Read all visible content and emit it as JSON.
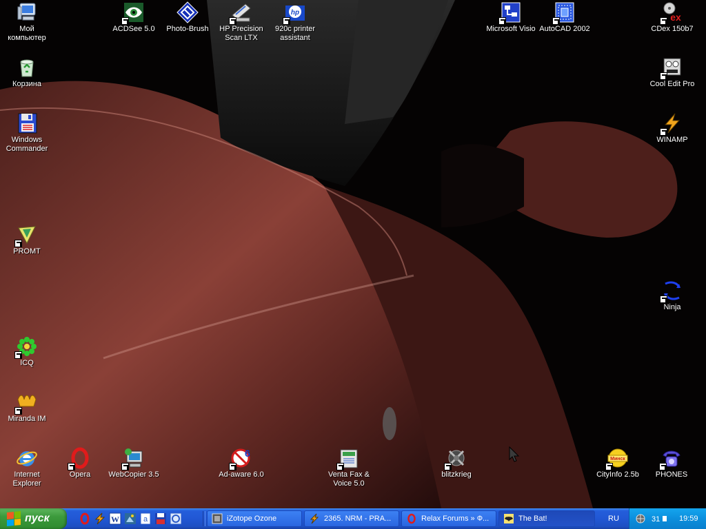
{
  "desktop": {
    "icons_left": [
      {
        "label": "Мой\nкомпьютер",
        "icon": "my-computer-icon",
        "shortcut": false
      },
      {
        "label": "Корзина",
        "icon": "recycle-bin-icon",
        "shortcut": false
      },
      {
        "label": "Windows\nCommander",
        "icon": "windows-commander-icon",
        "shortcut": false
      },
      {
        "label": "PROMT",
        "icon": "promt-icon",
        "shortcut": true
      },
      {
        "label": "ICQ",
        "icon": "icq-flower-icon",
        "shortcut": true
      },
      {
        "label": "Miranda IM",
        "icon": "miranda-icon",
        "shortcut": true
      },
      {
        "label": "Internet\nExplorer",
        "icon": "internet-explorer-icon",
        "shortcut": false
      }
    ],
    "icons_top": [
      {
        "label": "ACDSee 5.0",
        "icon": "acdsee-eye-icon",
        "shortcut": true
      },
      {
        "label": "Photo-Brush",
        "icon": "photo-brush-icon",
        "shortcut": false
      },
      {
        "label": "HP Precision\nScan LTX",
        "icon": "scanner-icon",
        "shortcut": true
      },
      {
        "label": "920c printer\nassistant",
        "icon": "hp-logo-icon",
        "shortcut": true
      },
      {
        "label": "Microsoft Visio",
        "icon": "visio-icon",
        "shortcut": true
      },
      {
        "label": "AutoCAD 2002",
        "icon": "autocad-icon",
        "shortcut": true
      }
    ],
    "icons_right": [
      {
        "label": "CDex 150b7",
        "icon": "cdex-icon",
        "shortcut": true
      },
      {
        "label": "Cool Edit Pro",
        "icon": "cool-edit-icon",
        "shortcut": true
      },
      {
        "label": "WINAMP",
        "icon": "winamp-bolt-icon",
        "shortcut": true
      },
      {
        "label": "Ninja",
        "icon": "ninja-arrows-icon",
        "shortcut": true
      }
    ],
    "icons_bottom": [
      {
        "label": "Opera",
        "icon": "opera-icon",
        "shortcut": true
      },
      {
        "label": "WebCopier 3.5",
        "icon": "webcopier-icon",
        "shortcut": true
      },
      {
        "label": "Ad-aware 6.0",
        "icon": "adaware-icon",
        "shortcut": true
      },
      {
        "label": "Venta Fax &\nVoice 5.0",
        "icon": "ventafax-icon",
        "shortcut": true
      },
      {
        "label": "blitzkrieg",
        "icon": "blitzkrieg-icon",
        "shortcut": true
      },
      {
        "label": "CityInfo 2.5b",
        "icon": "cityinfo-icon",
        "shortcut": true
      },
      {
        "label": "PHONES",
        "icon": "phone-icon",
        "shortcut": true
      }
    ],
    "cityinfo_badge": "Минск"
  },
  "taskbar": {
    "start_label": "пуск",
    "quick_launch": [
      "opera-icon",
      "winamp-icon",
      "word-icon",
      "photoshop-icon",
      "ie-page-icon",
      "floppy-save-icon",
      "ie-icon"
    ],
    "tasks": [
      {
        "title": "iZotope Ozone",
        "icon": "izotope-icon",
        "active": false
      },
      {
        "title": "2365. NRM - PRA...",
        "icon": "winamp-icon",
        "active": false
      },
      {
        "title": "Relax Forums » Ф...",
        "icon": "opera-icon",
        "active": false
      },
      {
        "title": "The Bat!",
        "icon": "bat-icon",
        "active": true
      }
    ],
    "language": "RU",
    "tray_date_badge": "31",
    "clock": "19:59"
  },
  "colors": {
    "taskbar_blue": "#245edb",
    "start_green": "#3c9a3c",
    "tray_blue": "#0c8fdd",
    "wallpaper_red": "#6e302b"
  }
}
